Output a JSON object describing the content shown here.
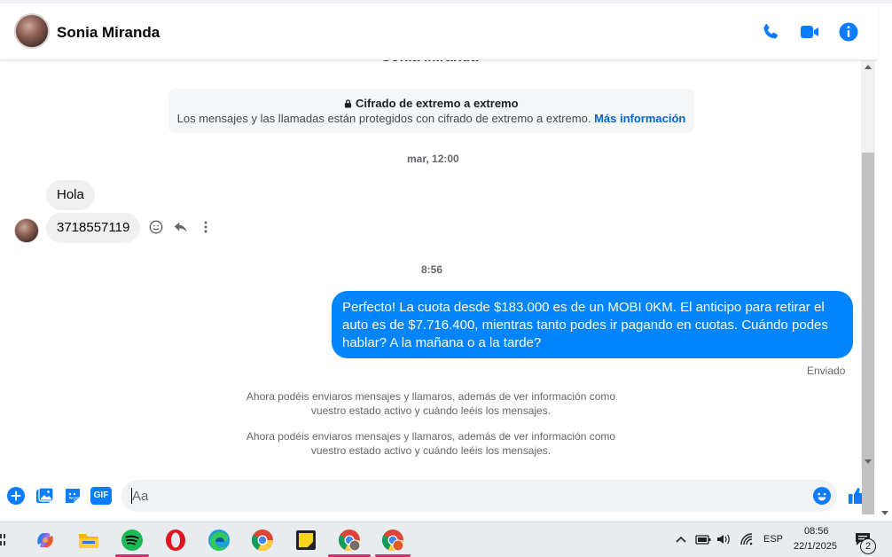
{
  "conversation": {
    "name": "Sonia Miranda",
    "ghost_name": "Sonia Miranda",
    "encryption_title": "Cifrado de extremo a extremo",
    "encryption_desc": "Los mensajes y las llamadas están protegidos con cifrado de extremo a extremo.",
    "encryption_link": "Más información"
  },
  "messages": {
    "time1": "mar, 12:00",
    "in1": "Hola",
    "in2": "3718557119",
    "time2": "8:56",
    "out1": "Perfecto! La cuota desde $183.000 es de un MOBI 0KM. El anticipo para retirar el auto es de $7.716.400, mientras tanto podes ir pagando en cuotas. Cuándo podes hablar? A la mañana o a la tarde?",
    "status": "Enviado",
    "system1_line1": "Ahora podéis enviaros mensajes y llamaros, además de ver información como",
    "system1_line2": "vuestro estado activo y cuándo leéis los mensajes.",
    "system2_line1": "Ahora podéis enviaros mensajes y llamaros, además de ver información como",
    "system2_line2": "vuestro estado activo y cuándo leéis los mensajes."
  },
  "composer": {
    "placeholder": "Aa",
    "icons": [
      "plus-icon",
      "image-icon",
      "sticker-icon",
      "gif-icon",
      "emoji-icon",
      "like-icon"
    ],
    "gif_label": "GIF"
  },
  "header_icons": [
    "phone-icon",
    "video-icon",
    "info-icon"
  ],
  "colors": {
    "accent": "#0084ff",
    "icon_blue": "#0a7cff",
    "bubble_in": "#f0f0f0"
  },
  "taskbar": {
    "apps": [
      "copilot",
      "file-explorer",
      "spotify",
      "opera",
      "edge",
      "chrome",
      "sticky-notes",
      "chrome-profile-1",
      "chrome-profile-2"
    ],
    "language": "ESP",
    "time": "08:56",
    "date": "22/1/2025",
    "notifications": "2"
  }
}
